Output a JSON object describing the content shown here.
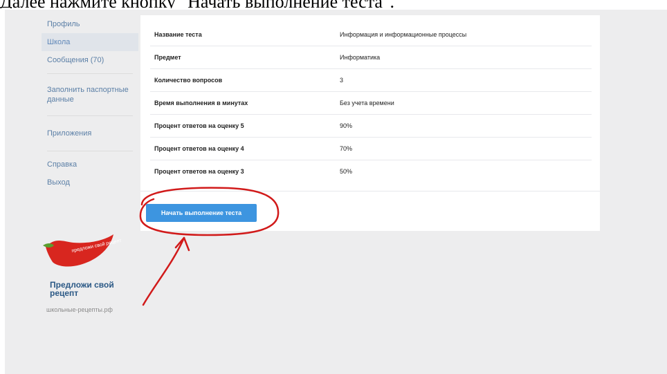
{
  "caption": "Далее нажмите кнопку \"Начать выполнение теста\".",
  "sidebar": {
    "items": [
      {
        "label": "Профиль",
        "active": false
      },
      {
        "label": "Школа",
        "active": true
      },
      {
        "label": "Сообщения (70)",
        "active": false
      },
      {
        "label": "Заполнить паспортные данные",
        "active": false
      },
      {
        "label": "Приложения",
        "active": false
      },
      {
        "label": "Справка",
        "active": false
      },
      {
        "label": "Выход",
        "active": false
      }
    ],
    "promo": {
      "chili_text": "предложи свой рецепт",
      "title": "Предложи свой рецепт",
      "site": "школьные-рецепты.рф"
    }
  },
  "test_info": {
    "rows": [
      {
        "label": "Название теста",
        "value": "Информация и информационные процессы"
      },
      {
        "label": "Предмет",
        "value": "Информатика"
      },
      {
        "label": "Количество вопросов",
        "value": "3"
      },
      {
        "label": "Время выполнения в минутах",
        "value": "Без учета времени"
      },
      {
        "label": "Процент ответов на оценку 5",
        "value": "90%"
      },
      {
        "label": "Процент ответов на оценку 4",
        "value": "70%"
      },
      {
        "label": "Процент ответов на оценку 3",
        "value": "50%"
      }
    ],
    "start_button_label": "Начать выполнение теста"
  },
  "colors": {
    "accent": "#3d95e0",
    "annotation": "#d11a1a",
    "link": "#5b7fa6"
  }
}
